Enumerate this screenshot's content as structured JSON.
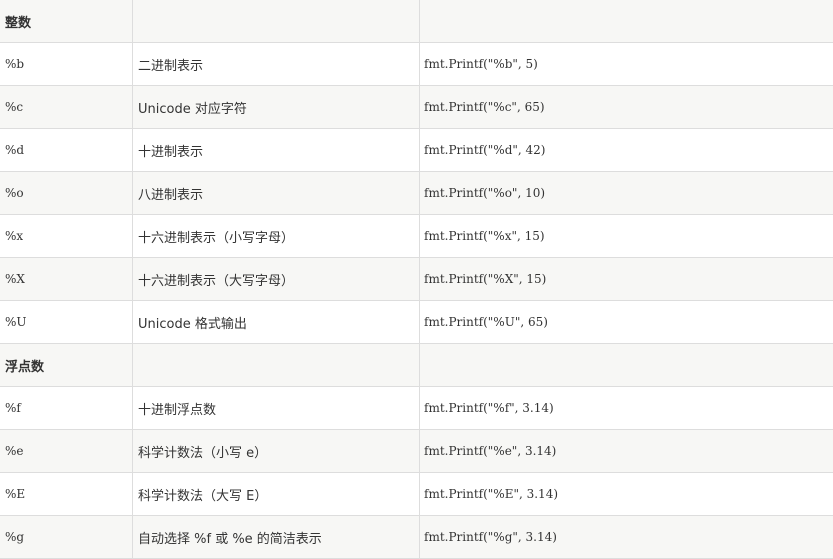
{
  "sections": [
    {
      "title": "整数",
      "rows": [
        {
          "verb": "%b",
          "desc": "二进制表示",
          "example": "fmt.Printf(\"%b\", 5)"
        },
        {
          "verb": "%c",
          "desc": "Unicode 对应字符",
          "example": "fmt.Printf(\"%c\", 65)"
        },
        {
          "verb": "%d",
          "desc": "十进制表示",
          "example": "fmt.Printf(\"%d\", 42)"
        },
        {
          "verb": "%o",
          "desc": "八进制表示",
          "example": "fmt.Printf(\"%o\", 10)"
        },
        {
          "verb": "%x",
          "desc": "十六进制表示（小写字母）",
          "example": "fmt.Printf(\"%x\", 15)"
        },
        {
          "verb": "%X",
          "desc": "十六进制表示（大写字母）",
          "example": "fmt.Printf(\"%X\", 15)"
        },
        {
          "verb": "%U",
          "desc": "Unicode 格式输出",
          "example": "fmt.Printf(\"%U\", 65)"
        }
      ]
    },
    {
      "title": "浮点数",
      "rows": [
        {
          "verb": "%f",
          "desc": "十进制浮点数",
          "example": "fmt.Printf(\"%f\", 3.14)"
        },
        {
          "verb": "%e",
          "desc": "科学计数法（小写 e）",
          "example": "fmt.Printf(\"%e\", 3.14)"
        },
        {
          "verb": "%E",
          "desc": "科学计数法（大写 E）",
          "example": "fmt.Printf(\"%E\", 3.14)"
        },
        {
          "verb": "%g",
          "desc": "自动选择 %f 或 %e 的简洁表示",
          "example": "fmt.Printf(\"%g\", 3.14)"
        }
      ]
    }
  ]
}
